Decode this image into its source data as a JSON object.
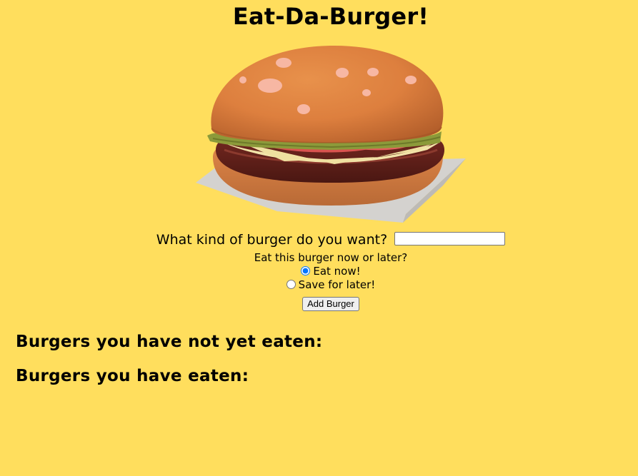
{
  "page": {
    "title": "Eat-Da-Burger!"
  },
  "hero_image": {
    "icon": "burger-illustration"
  },
  "form": {
    "question_label": "What kind of burger do you want?",
    "burger_name_value": "",
    "timing_label": "Eat this burger now or later?",
    "options": [
      {
        "label": "Eat now!",
        "checked": true
      },
      {
        "label": "Save for later!",
        "checked": false
      }
    ],
    "submit_label": "Add Burger"
  },
  "sections": {
    "not_eaten_heading": "Burgers you have not yet eaten:",
    "not_eaten_items": [],
    "eaten_heading": "Burgers you have eaten:",
    "eaten_items": []
  },
  "colors": {
    "background": "#ffde5d",
    "text": "#000000",
    "radio_accent": "#0a66d8"
  }
}
